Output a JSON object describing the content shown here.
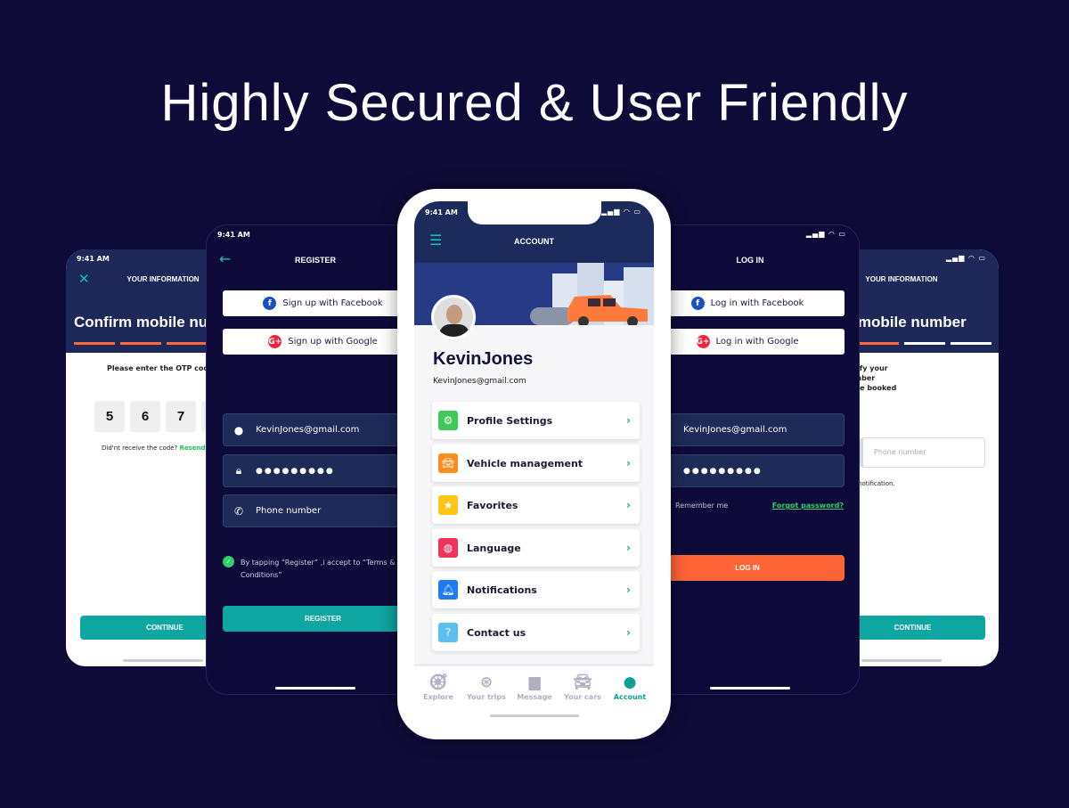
{
  "headline": "Highly Secured & User Friendly",
  "status_time": "9:41 AM",
  "status_icons": "signal wifi battery",
  "info_left": {
    "header": "YOUR INFORMATION",
    "title": "Confirm mobile number",
    "prompt": "Please enter the OTP code",
    "otp": [
      "5",
      "6",
      "7"
    ],
    "resend_q": "Did'nt receive the code?",
    "resend_link": "Resend",
    "continue": "CONTINUE"
  },
  "info_right": {
    "header": "YOUR INFORMATION",
    "title": "Confirm mobile number",
    "prompt_lines": [
      "Please enter the OTP code to verify your",
      "phone. We 'll only share your number",
      "with the host or guest after you've booked"
    ],
    "phone_placeholder": "Phone number",
    "note": "You'll get a text message notification.",
    "continue": "CONTINUE"
  },
  "register": {
    "header": "REGISTER",
    "facebook": "Sign up with Facebook",
    "google": "Sign up with Google",
    "email": "KevinJones@gmail.com",
    "password": "●●●●●●●●●",
    "phone_placeholder": "Phone number",
    "terms": "By tapping “Register” ,i accept to “Terms & Conditions”",
    "button": "REGISTER"
  },
  "login": {
    "header": "LOG IN",
    "facebook": "Log in with Facebook",
    "google": "Log in with Google",
    "email": "KevinJones@gmail.com",
    "password": "●●●●●●●●●",
    "remember": "Remember me",
    "forgot": "Forgot password?",
    "button": "LOG IN"
  },
  "account": {
    "header": "ACCOUNT",
    "name": "KevinJones",
    "email": "KevinJones@gmail.com",
    "menu": [
      {
        "label": "Profile Settings",
        "icon": "gear-icon",
        "color": "#3ec95a"
      },
      {
        "label": "Vehicle management",
        "icon": "car-icon",
        "color": "#ff8a1e"
      },
      {
        "label": "Favorites",
        "icon": "star-icon",
        "color": "#ffc517"
      },
      {
        "label": "Language",
        "icon": "globe-icon",
        "color": "#f0335a"
      },
      {
        "label": "Notifications",
        "icon": "bell-icon",
        "color": "#1e7cf2"
      },
      {
        "label": "Contact us",
        "icon": "help-icon",
        "color": "#5bc0f0"
      }
    ],
    "tabs": [
      {
        "label": "Explore"
      },
      {
        "label": "Your trips"
      },
      {
        "label": "Message"
      },
      {
        "label": "Your cars"
      },
      {
        "label": "Account",
        "active": true
      }
    ]
  },
  "colors": {
    "background": "#0e0b38",
    "teal": "#0fa5a0",
    "orange": "#ff6a3d",
    "navy": "#1d2858",
    "green": "#22b35c"
  }
}
